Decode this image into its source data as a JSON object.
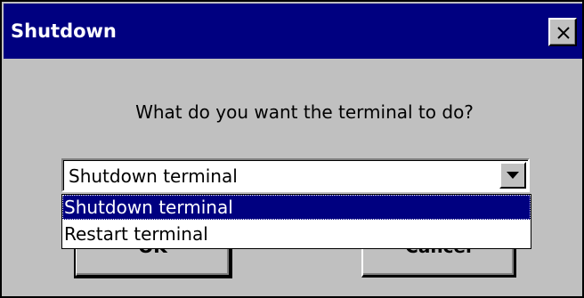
{
  "window": {
    "title": "Shutdown",
    "close_icon": "close-icon"
  },
  "dialog": {
    "prompt": "What do you want the terminal to do?"
  },
  "combo": {
    "selected_value": "Shutdown terminal",
    "arrow_icon": "chevron-down-icon",
    "options": [
      {
        "label": "Shutdown terminal",
        "selected": true
      },
      {
        "label": "Restart terminal",
        "selected": false
      }
    ]
  },
  "buttons": {
    "ok_label": "OK",
    "cancel_label": "Cancel"
  },
  "colors": {
    "titlebar": "#000080",
    "face": "#c0c0c0",
    "selection": "#000080"
  }
}
